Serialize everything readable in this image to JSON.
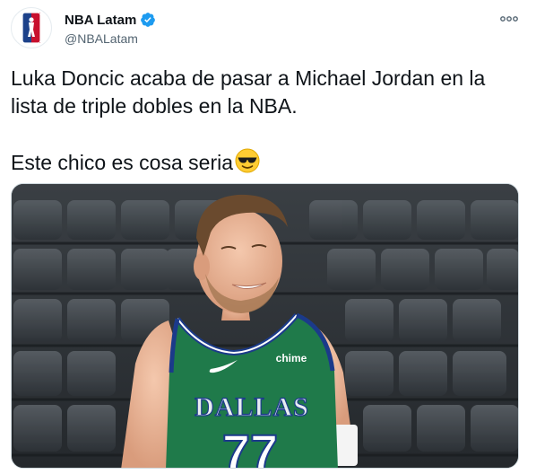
{
  "account": {
    "display_name": "NBA Latam",
    "handle": "@NBALatam",
    "verified": true,
    "avatar_icon": "nba-logo-icon"
  },
  "tweet": {
    "line1": "Luka Doncic acaba de pasar a Michael Jordan en la lista de triple dobles en la NBA.",
    "line2": "Este chico es cosa seria",
    "emoji": "sunglasses-emoji"
  },
  "media": {
    "jersey_team": "DALLAS",
    "jersey_number": "77",
    "sponsor": "chime"
  },
  "colors": {
    "verified": "#1d9bf0",
    "jersey_green": "#1f7a4a",
    "jersey_trim": "#1b3a8a"
  }
}
